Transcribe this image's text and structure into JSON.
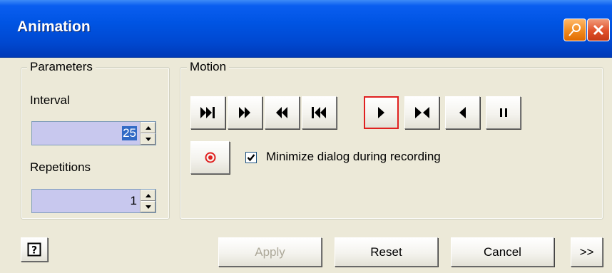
{
  "window": {
    "title": "Animation",
    "pin_icon": "pin-icon",
    "close_icon": "close-icon"
  },
  "parameters": {
    "legend": "Parameters",
    "interval_label": "Interval",
    "interval_value": "25",
    "repetitions_label": "Repetitions",
    "repetitions_value": "1"
  },
  "motion": {
    "legend": "Motion",
    "buttons": [
      {
        "name": "step-forward-to-end",
        "icon": "skip-to-end-icon"
      },
      {
        "name": "fast-forward",
        "icon": "fast-forward-icon"
      },
      {
        "name": "rewind",
        "icon": "rewind-icon"
      },
      {
        "name": "skip-to-start",
        "icon": "skip-to-start-icon"
      },
      {
        "name": "play",
        "icon": "play-icon",
        "selected": true
      },
      {
        "name": "play-both-directions",
        "icon": "bidirectional-icon"
      },
      {
        "name": "play-reverse",
        "icon": "reverse-icon"
      },
      {
        "name": "pause",
        "icon": "pause-icon"
      }
    ],
    "record_icon": "record-icon",
    "minimize_label": "Minimize dialog during recording",
    "minimize_checked": true
  },
  "footer": {
    "help_icon": "help-icon",
    "apply_label": "Apply",
    "reset_label": "Reset",
    "cancel_label": "Cancel",
    "more_label": ">>"
  },
  "colors": {
    "titlebar": "#0054e3",
    "dialog_bg": "#ece9d8",
    "selection_outline": "#e02020",
    "input_bg": "#c8c8ee",
    "record_red": "#e02020"
  }
}
